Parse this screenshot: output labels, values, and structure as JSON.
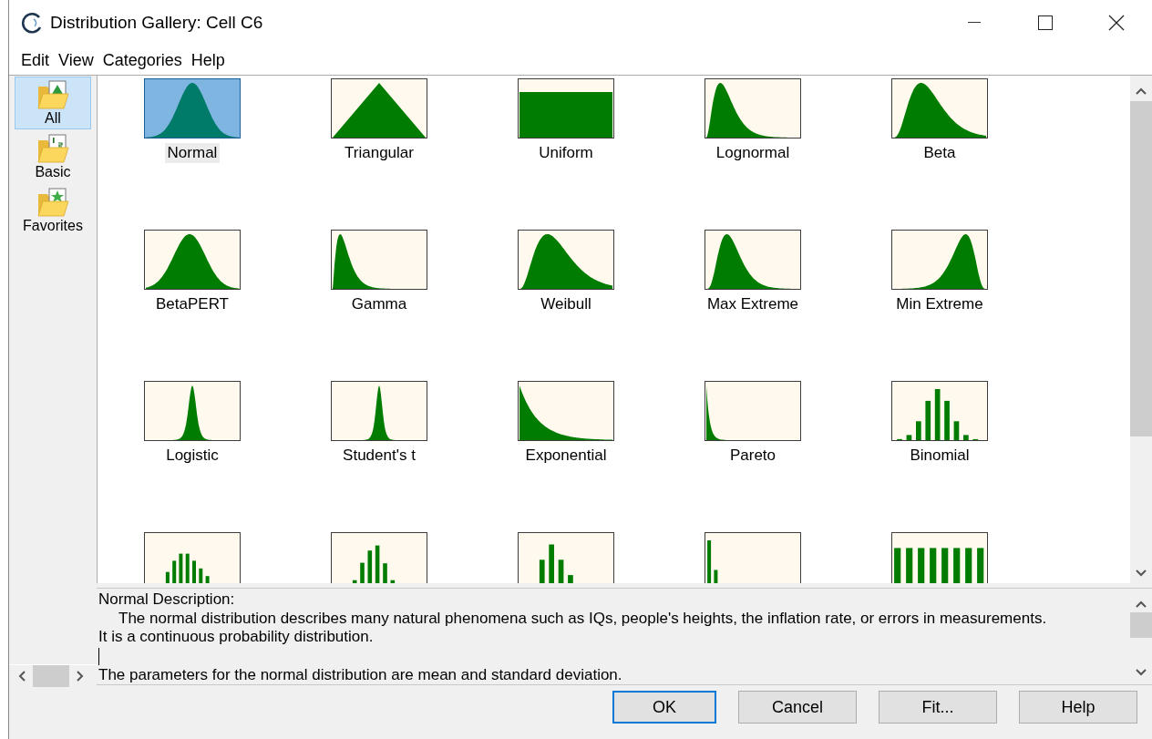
{
  "window": {
    "title": "Distribution Gallery: Cell C6"
  },
  "menu": [
    "Edit",
    "View",
    "Categories",
    "Help"
  ],
  "sidebar": {
    "items": [
      {
        "label": "All",
        "selected": true,
        "kind": "chart"
      },
      {
        "label": "Basic",
        "selected": false,
        "kind": "numbers"
      },
      {
        "label": "Favorites",
        "selected": false,
        "kind": "star"
      }
    ]
  },
  "gallery": {
    "items": [
      {
        "label": "Normal",
        "kind": "bell",
        "selected": true
      },
      {
        "label": "Triangular",
        "kind": "triangle",
        "selected": false
      },
      {
        "label": "Uniform",
        "kind": "flat",
        "selected": false
      },
      {
        "label": "Lognormal",
        "kind": "skewed",
        "selected": false
      },
      {
        "label": "Beta",
        "kind": "hump",
        "selected": false
      },
      {
        "label": "BetaPERT",
        "kind": "broadbell",
        "selected": false
      },
      {
        "label": "Gamma",
        "kind": "steepskew",
        "selected": false
      },
      {
        "label": "Weibull",
        "kind": "rounded",
        "selected": false
      },
      {
        "label": "Max Extreme",
        "kind": "peakskew",
        "selected": false
      },
      {
        "label": "Min Extreme",
        "kind": "leftskew",
        "selected": false
      },
      {
        "label": "Logistic",
        "kind": "narrow",
        "selected": false
      },
      {
        "label": "Student's t",
        "kind": "sharp",
        "selected": false
      },
      {
        "label": "Exponential",
        "kind": "decay",
        "selected": false
      },
      {
        "label": "Pareto",
        "kind": "steepdecay",
        "selected": false
      },
      {
        "label": "Binomial",
        "kind": "barsbell",
        "selected": false
      },
      {
        "kind": "barswide",
        "selected": false
      },
      {
        "kind": "barsskew",
        "selected": false
      },
      {
        "kind": "barspeak",
        "selected": false
      },
      {
        "kind": "barsdecay",
        "selected": false
      },
      {
        "kind": "barsflat",
        "selected": false
      }
    ]
  },
  "description": {
    "heading": "Normal Description:",
    "text": [
      "The normal distribution describes many natural phenomena such as IQs, people's heights, the inflation rate, or errors in measurements.",
      "It is a continuous probability distribution."
    ],
    "parameters": "The parameters for the normal distribution are mean and standard deviation."
  },
  "buttons": [
    {
      "label": "OK",
      "default": true
    },
    {
      "label": "Cancel",
      "default": false
    },
    {
      "label": "Fit...",
      "default": false
    },
    {
      "label": "Help",
      "default": false
    }
  ]
}
